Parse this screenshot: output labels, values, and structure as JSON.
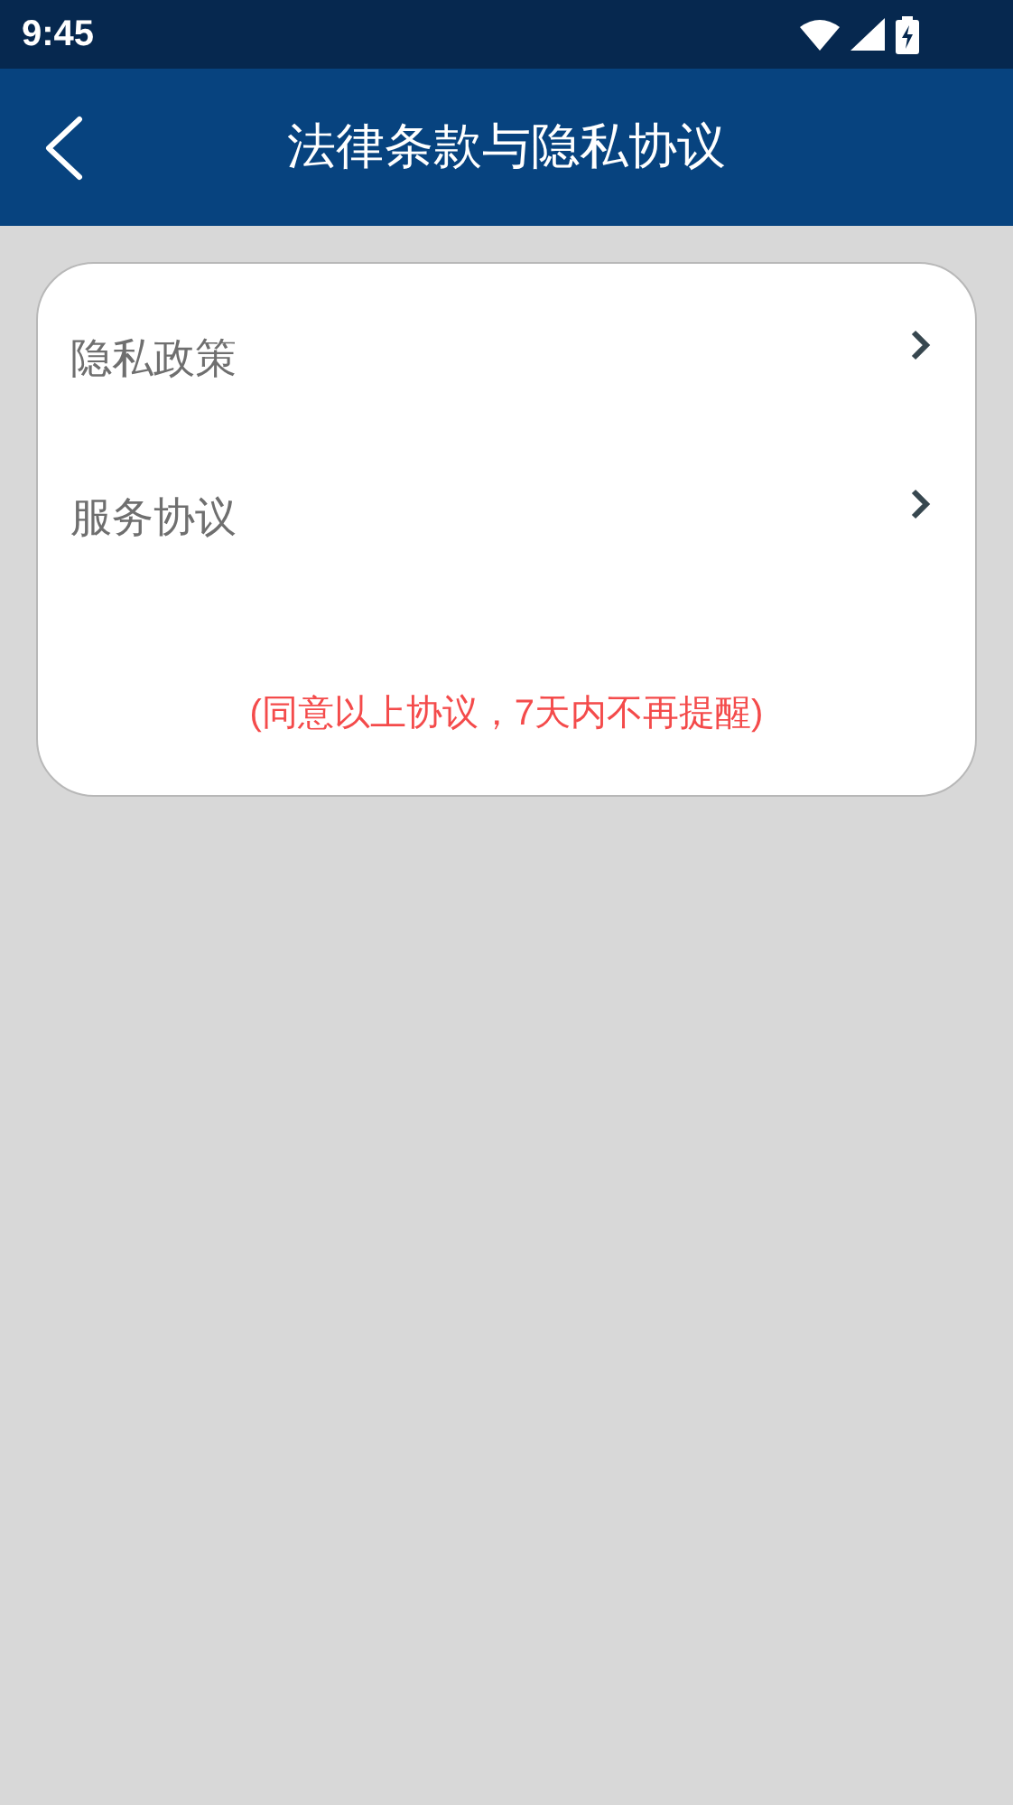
{
  "status_bar": {
    "time": "9:45"
  },
  "header": {
    "title": "法律条款与隐私协议"
  },
  "items": [
    {
      "label": "隐私政策"
    },
    {
      "label": "服务协议"
    }
  ],
  "note": "(同意以上协议，7天内不再提醒)"
}
